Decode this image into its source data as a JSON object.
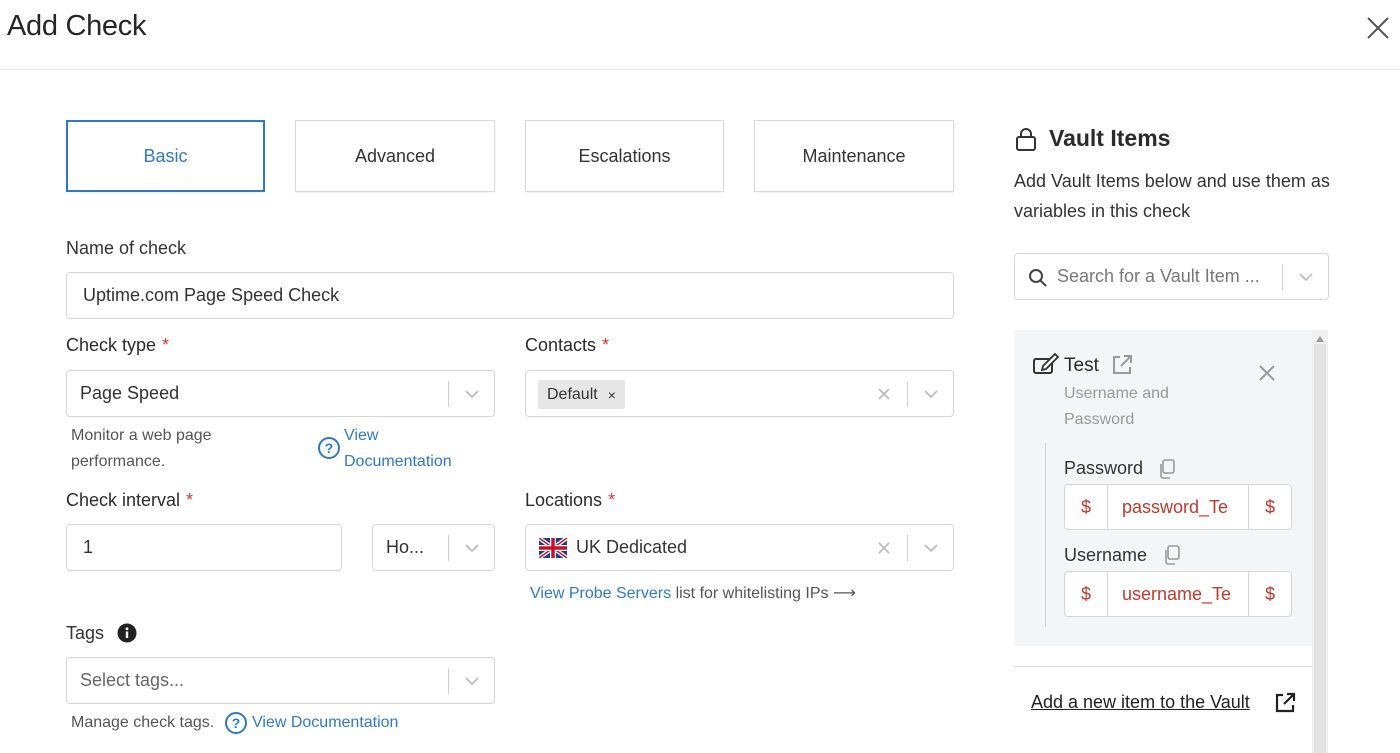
{
  "modal": {
    "title": "Add Check"
  },
  "tabs": [
    {
      "label": "Basic",
      "active": true
    },
    {
      "label": "Advanced",
      "active": false
    },
    {
      "label": "Escalations",
      "active": false
    },
    {
      "label": "Maintenance",
      "active": false
    }
  ],
  "form": {
    "name": {
      "label": "Name of check",
      "value": "Uptime.com Page Speed Check"
    },
    "check_type": {
      "label": "Check type",
      "required": "*",
      "value": "Page Speed",
      "help": "Monitor a web page performance.",
      "help_link": "View Documentation"
    },
    "contacts": {
      "label": "Contacts",
      "required": "*",
      "chip": "Default",
      "chip_remove": "×"
    },
    "interval": {
      "label": "Check interval",
      "required": "*",
      "value": "1",
      "unit": "Ho..."
    },
    "locations": {
      "label": "Locations",
      "required": "*",
      "value": "UK Dedicated",
      "probe_link": "View Probe Servers",
      "probe_text": "list for whitelisting IPs ⟶"
    },
    "tags": {
      "label": "Tags",
      "placeholder": "Select tags...",
      "help": "Manage check tags.",
      "help_link": "View Documentation"
    }
  },
  "vault": {
    "title": "Vault Items",
    "description": "Add Vault Items below and use them as variables in this check",
    "search_placeholder": "Search for a Vault Item ...",
    "item": {
      "name": "Test",
      "type": "Username and Password",
      "fields": [
        {
          "label": "Password",
          "prefix": "$",
          "value": "password_Te",
          "suffix": "$"
        },
        {
          "label": "Username",
          "prefix": "$",
          "value": "username_Te",
          "suffix": "$"
        }
      ]
    },
    "add_link": "Add a new item to the Vault"
  },
  "colors": {
    "accent": "#2f79c4",
    "required": "#dd3333",
    "variable": "#c0392b"
  }
}
